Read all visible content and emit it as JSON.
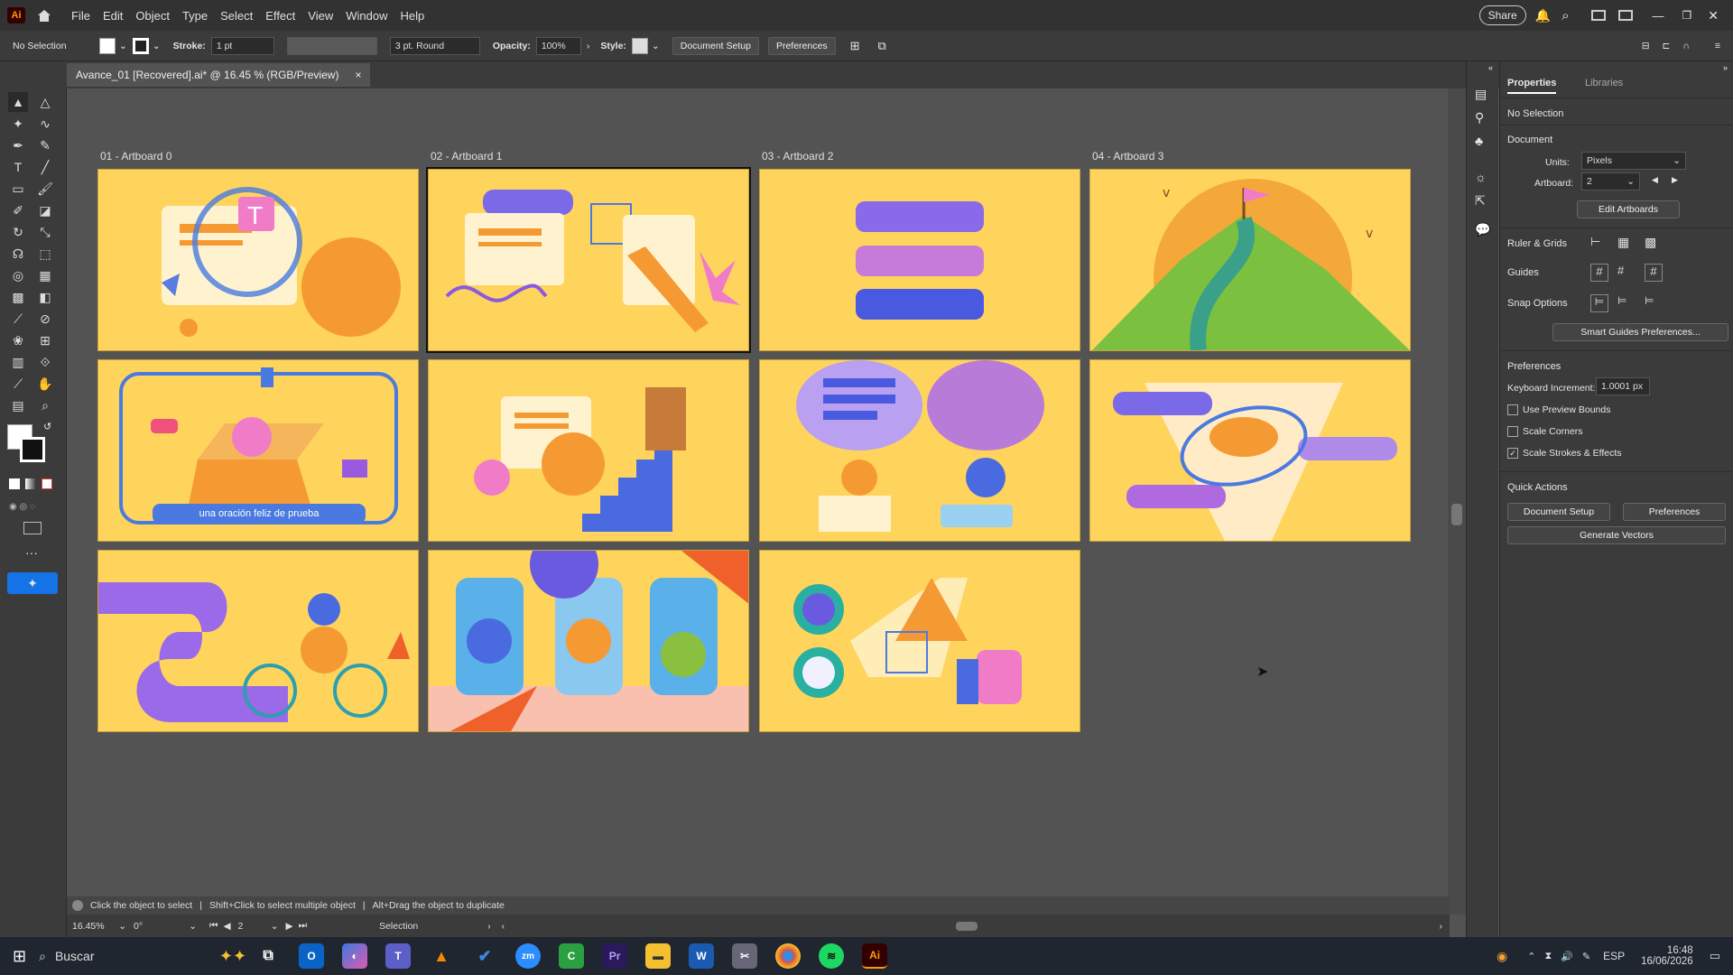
{
  "app": {
    "logo": "Ai",
    "home_icon": "home-icon"
  },
  "menu": [
    "File",
    "Edit",
    "Object",
    "Type",
    "Select",
    "Effect",
    "View",
    "Window",
    "Help"
  ],
  "topright": {
    "share": "Share"
  },
  "control": {
    "selection": "No Selection",
    "stroke_label": "Stroke:",
    "stroke_value": "1 pt",
    "brush": "3 pt. Round",
    "opacity_label": "Opacity:",
    "opacity_value": "100%",
    "style_label": "Style:",
    "doc_setup": "Document Setup",
    "preferences": "Preferences"
  },
  "doc_tab": {
    "title": "Avance_01 [Recovered].ai* @ 16.45 % (RGB/Preview)",
    "close": "×"
  },
  "artboard_labels": [
    "01 - Artboard 0",
    "02 - Artboard 1",
    "03 - Artboard 2",
    "04 - Artboard 3"
  ],
  "artboard_text": "una oración feliz de prueba",
  "status": {
    "help": "Click the object to select",
    "sep1": "|",
    "shift": "Shift+Click to select multiple object",
    "sep2": "|",
    "alt": "Alt+Drag the object to duplicate"
  },
  "zoom": {
    "zoom": "16.45%",
    "angle": "0°",
    "artboard": "2",
    "tool": "Selection"
  },
  "props": {
    "tab_props": "Properties",
    "tab_libs": "Libraries",
    "no_selection": "No Selection",
    "document": "Document",
    "units_label": "Units:",
    "units_value": "Pixels",
    "artboard_label": "Artboard:",
    "artboard_value": "2",
    "edit_artboards": "Edit Artboards",
    "ruler_grids": "Ruler & Grids",
    "guides": "Guides",
    "snap_options": "Snap Options",
    "smart_guides": "Smart Guides Preferences...",
    "preferences_head": "Preferences",
    "keyboard_label": "Keyboard Increment:",
    "keyboard_value": "1.0001 px",
    "use_preview": "Use Preview Bounds",
    "scale_corners": "Scale Corners",
    "scale_strokes": "Scale Strokes & Effects",
    "quick_actions": "Quick Actions",
    "qa_doc_setup": "Document Setup",
    "qa_prefs": "Preferences",
    "generate_vectors": "Generate Vectors"
  },
  "taskbar": {
    "search": "Buscar",
    "lang": "ESP",
    "time": "16:48",
    "date": "16/06/2026"
  }
}
